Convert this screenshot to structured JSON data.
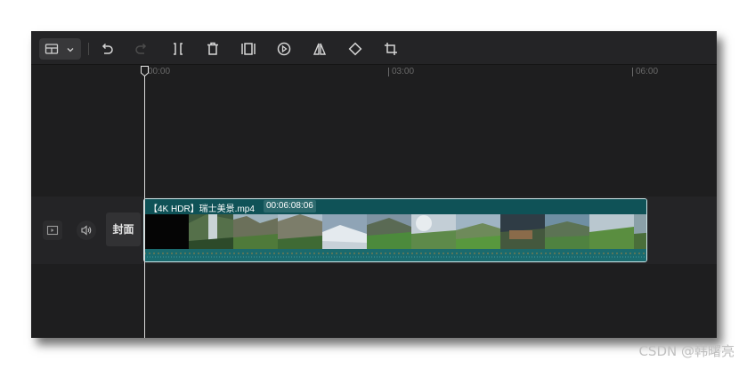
{
  "toolbar": {
    "tools": [
      {
        "icon": "layout-icon"
      },
      {
        "icon": "undo-icon"
      },
      {
        "icon": "redo-icon"
      },
      {
        "icon": "split-icon"
      },
      {
        "icon": "delete-icon"
      },
      {
        "icon": "crop-frame-icon"
      },
      {
        "icon": "play-circle-icon"
      },
      {
        "icon": "mirror-icon"
      },
      {
        "icon": "rotate-icon"
      },
      {
        "icon": "crop-icon"
      }
    ]
  },
  "ruler": {
    "ticks": [
      "00:00",
      "03:00",
      "06:00"
    ]
  },
  "track": {
    "cover_label": "封面",
    "clip": {
      "name": "【4K HDR】瑞士美景.mp4",
      "duration": "00:06:08:06"
    }
  },
  "colors": {
    "clip_bg": "#0f5257",
    "clip_border": "#cfe6e8",
    "wave": "#1a6a6e",
    "waveform_accent": "#c48a3a"
  },
  "watermark": "CSDN @韩曙亮"
}
